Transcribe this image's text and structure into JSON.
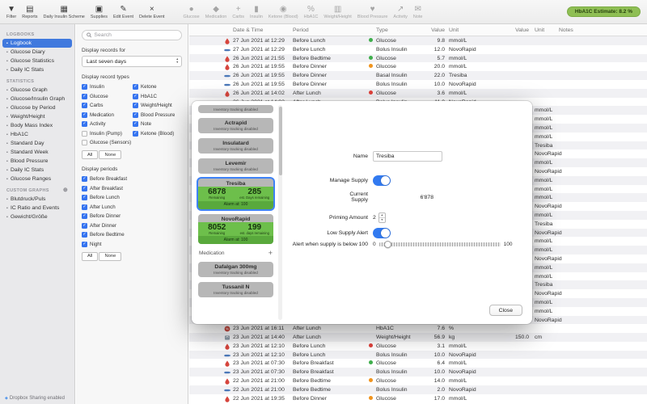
{
  "toolbar": {
    "badge": "HbA1C Estimate: 8.2 %",
    "items": [
      {
        "label": "Filter",
        "icon": "filter-icon"
      },
      {
        "label": "Reports",
        "icon": "reports-icon"
      },
      {
        "label": "Daily Insulin Scheme",
        "icon": "insulin-scheme-icon"
      },
      {
        "label": "Supplies",
        "icon": "supplies-icon"
      },
      {
        "label": "Edit Event",
        "icon": "edit-event-icon"
      },
      {
        "label": "Delete Event",
        "icon": "delete-event-icon"
      },
      {
        "label": "Glucose",
        "icon": "glucose-icon",
        "disabled": true,
        "group_start": true
      },
      {
        "label": "Medication",
        "icon": "medication-icon",
        "disabled": true
      },
      {
        "label": "Carbs",
        "icon": "carbs-icon",
        "disabled": true
      },
      {
        "label": "Insulin",
        "icon": "insulin-icon",
        "disabled": true
      },
      {
        "label": "Ketone (Blood)",
        "icon": "ketone-blood-icon",
        "disabled": true
      },
      {
        "label": "HbA1C",
        "icon": "hba1c-icon",
        "disabled": true
      },
      {
        "label": "Weight/Height",
        "icon": "weight-height-icon",
        "disabled": true
      },
      {
        "label": "Blood Pressure",
        "icon": "blood-pressure-icon",
        "disabled": true
      },
      {
        "label": "Activity",
        "icon": "activity-icon",
        "disabled": true
      },
      {
        "label": "Note",
        "icon": "note-icon",
        "disabled": true
      }
    ]
  },
  "sidebar": {
    "footer": "Dropbox Sharing enabled",
    "sections": [
      {
        "title": "LOGBOOKS",
        "items": [
          {
            "label": "Logbook",
            "selected": true
          },
          {
            "label": "Glucose Diary"
          },
          {
            "label": "Glucose Statistics"
          },
          {
            "label": "Daily IC Stats"
          }
        ]
      },
      {
        "title": "STATISTICS",
        "items": [
          {
            "label": "Glucose Graph"
          },
          {
            "label": "Glucose/Insulin Graph"
          },
          {
            "label": "Glucose by Period"
          },
          {
            "label": "Weight/Height"
          },
          {
            "label": "Body Mass Index"
          },
          {
            "label": "HbA1C"
          },
          {
            "label": "Standard Day"
          },
          {
            "label": "Standard Week"
          },
          {
            "label": "Blood Pressure"
          },
          {
            "label": "Daily IC Stats"
          },
          {
            "label": "Glucose Ranges"
          }
        ]
      },
      {
        "title": "CUSTOM GRAPHS",
        "plus": true,
        "items": [
          {
            "label": "Blutdruck/Puls"
          },
          {
            "label": "IC Ratio and Events"
          },
          {
            "label": "Gewicht/Größe"
          }
        ]
      }
    ]
  },
  "filters": {
    "search_placeholder": "Search",
    "records_for_label": "Display records for",
    "range_value": "Last seven days",
    "types_label": "Display record types",
    "record_types": [
      {
        "label": "Insulin",
        "checked": true
      },
      {
        "label": "Ketone",
        "checked": true
      },
      {
        "label": "Glucose",
        "checked": true
      },
      {
        "label": "HbA1C",
        "checked": true
      },
      {
        "label": "Carbs",
        "checked": true
      },
      {
        "label": "Weight/Height",
        "checked": true
      },
      {
        "label": "Medication",
        "checked": true
      },
      {
        "label": "Blood Pressure",
        "checked": true
      },
      {
        "label": "Activity",
        "checked": true
      },
      {
        "label": "Note",
        "checked": true
      },
      {
        "label": "Insulin (Pump)",
        "checked": false
      },
      {
        "label": "Ketone (Blood)",
        "checked": true
      },
      {
        "label": "Glucose (Sensors)",
        "checked": false
      }
    ],
    "all_label": "All",
    "none_label": "None",
    "periods_label": "Display periods",
    "periods": [
      {
        "label": "Before Breakfast",
        "checked": true
      },
      {
        "label": "After Breakfast",
        "checked": true
      },
      {
        "label": "Before Lunch",
        "checked": true
      },
      {
        "label": "After Lunch",
        "checked": true
      },
      {
        "label": "Before Dinner",
        "checked": true
      },
      {
        "label": "After Dinner",
        "checked": true
      },
      {
        "label": "Before Bedtime",
        "checked": true
      },
      {
        "label": "Night",
        "checked": true
      }
    ]
  },
  "table": {
    "columns": [
      "Date & Time",
      "Period",
      "Type",
      "Value",
      "Unit",
      "Value",
      "Unit",
      "Notes"
    ],
    "rows": [
      {
        "icon": "glucose",
        "dt": "27 Jun 2021 at 12:29",
        "period": "Before Lunch",
        "type": "Glucose",
        "dot": "green",
        "v1": "9.8",
        "u1": "mmol/L"
      },
      {
        "icon": "insulin",
        "dt": "27 Jun 2021 at 12:29",
        "period": "Before Lunch",
        "type": "Bolus Insulin",
        "v1": "12.0",
        "u1": "NovoRapid"
      },
      {
        "icon": "glucose",
        "dt": "26 Jun 2021 at 21:55",
        "period": "Before Bedtime",
        "type": "Glucose",
        "dot": "green",
        "v1": "5.7",
        "u1": "mmol/L"
      },
      {
        "icon": "glucose",
        "dt": "26 Jun 2021 at 19:55",
        "period": "Before Dinner",
        "type": "Glucose",
        "dot": "orange",
        "v1": "20.0",
        "u1": "mmol/L"
      },
      {
        "icon": "insulin",
        "dt": "26 Jun 2021 at 19:55",
        "period": "Before Dinner",
        "type": "Basal Insulin",
        "v1": "22.0",
        "u1": "Tresiba"
      },
      {
        "icon": "insulin",
        "dt": "26 Jun 2021 at 19:55",
        "period": "Before Dinner",
        "type": "Bolus Insulin",
        "v1": "10.0",
        "u1": "NovoRapid"
      },
      {
        "icon": "glucose",
        "dt": "26 Jun 2021 at 14:02",
        "period": "After Lunch",
        "type": "Glucose",
        "dot": "red",
        "v1": "3.6",
        "u1": "mmol/L"
      },
      {
        "icon": "insulin",
        "dt": "26 Jun 2021 at 14:02",
        "period": "After Lunch",
        "type": "Bolus Insulin",
        "v1": "11.0",
        "u1": "NovoRapid"
      },
      {
        "occluded": true,
        "u2": "mmol/L"
      },
      {
        "occluded": true,
        "u2": "mmol/L"
      },
      {
        "occluded": true,
        "u2": "mmol/L"
      },
      {
        "occluded": true,
        "u2": "mmol/L"
      },
      {
        "occluded": true,
        "u2": "Tresiba"
      },
      {
        "occluded": true,
        "u2": "NovoRapid"
      },
      {
        "occluded": true,
        "u2": "mmol/L"
      },
      {
        "occluded": true,
        "u2": "NovoRapid"
      },
      {
        "occluded": true,
        "u2": "mmol/L"
      },
      {
        "occluded": true,
        "u2": "mmol/L"
      },
      {
        "occluded": true,
        "u2": "mmol/L"
      },
      {
        "occluded": true,
        "u2": "NovoRapid"
      },
      {
        "occluded": true,
        "u2": "mmol/L"
      },
      {
        "occluded": true,
        "u2": "Tresiba"
      },
      {
        "occluded": true,
        "u2": "NovoRapid"
      },
      {
        "occluded": true,
        "u2": "mmol/L"
      },
      {
        "occluded": true,
        "u2": "mmol/L"
      },
      {
        "occluded": true,
        "u2": "NovoRapid"
      },
      {
        "occluded": true,
        "u2": "mmol/L"
      },
      {
        "occluded": true,
        "u2": "mmol/L"
      },
      {
        "occluded": true,
        "u2": "Tresiba"
      },
      {
        "occluded": true,
        "u2": "NovoRapid"
      },
      {
        "occluded": true,
        "u2": "mmol/L"
      },
      {
        "occluded": true,
        "u2": "mmol/L"
      },
      {
        "occluded": true,
        "u2": "NovoRapid"
      },
      {
        "icon": "hba1c",
        "dt": "23 Jun 2021 at 16:11",
        "period": "After Lunch",
        "type": "HbA1C",
        "v1": "7.6",
        "u1": "%"
      },
      {
        "icon": "weight",
        "dt": "23 Jun 2021 at 14:40",
        "period": "After Lunch",
        "type": "Weight/Height",
        "v1": "56.9",
        "u1": "kg",
        "v2": "150.0",
        "u2": "cm"
      },
      {
        "icon": "glucose",
        "dt": "23 Jun 2021 at 12:10",
        "period": "Before Lunch",
        "type": "Glucose",
        "dot": "red",
        "v1": "3.1",
        "u1": "mmol/L"
      },
      {
        "icon": "insulin",
        "dt": "23 Jun 2021 at 12:10",
        "period": "Before Lunch",
        "type": "Bolus Insulin",
        "v1": "10.0",
        "u1": "NovoRapid"
      },
      {
        "icon": "glucose",
        "dt": "23 Jun 2021 at 07:30",
        "period": "Before Breakfast",
        "type": "Glucose",
        "dot": "green",
        "v1": "6.4",
        "u1": "mmol/L"
      },
      {
        "icon": "insulin",
        "dt": "23 Jun 2021 at 07:30",
        "period": "Before Breakfast",
        "type": "Bolus Insulin",
        "v1": "10.0",
        "u1": "NovoRapid"
      },
      {
        "icon": "glucose",
        "dt": "22 Jun 2021 at 21:00",
        "period": "Before Bedtime",
        "type": "Glucose",
        "dot": "orange",
        "v1": "14.0",
        "u1": "mmol/L"
      },
      {
        "icon": "insulin",
        "dt": "22 Jun 2021 at 21:00",
        "period": "Before Bedtime",
        "type": "Bolus Insulin",
        "v1": "2.0",
        "u1": "NovoRapid"
      },
      {
        "icon": "glucose",
        "dt": "22 Jun 2021 at 19:35",
        "period": "Before Dinner",
        "type": "Glucose",
        "dot": "orange",
        "v1": "17.0",
        "u1": "mmol/L"
      }
    ]
  },
  "dialog": {
    "supplies": [
      {
        "partial": true,
        "status": "Inventory tracking disabled"
      },
      {
        "name": "Actrapid",
        "status": "Inventory tracking disabled"
      },
      {
        "name": "Insulatard",
        "status": "Inventory tracking disabled"
      },
      {
        "name": "Levemir",
        "status": "Inventory tracking disabled"
      },
      {
        "name": "Tresiba",
        "selected": true,
        "remaining": "6878",
        "remaining_label": "Remaining",
        "days": "285",
        "days_label": "est. Days remaining",
        "alarm": "Alarm at: 100"
      },
      {
        "name": "NovoRapid",
        "remaining": "8052",
        "remaining_label": "Remaining",
        "days": "199",
        "days_label": "est. days remaining",
        "alarm": "Alarm at: 100"
      }
    ],
    "medication": {
      "title": "Medication",
      "add_label": "+"
    },
    "medications": [
      {
        "name": "Dafalgan 300mg",
        "status": "Inventory tracking disabled"
      },
      {
        "name": "Tussanil N",
        "status": "Inventory tracking disabled"
      }
    ],
    "form": {
      "name_label": "Name",
      "name_value": "Tresiba",
      "manage_label": "Manage Supply",
      "current_label": "Current Supply",
      "current_value": "6'878",
      "priming_label": "Priming Amount",
      "priming_value": "2",
      "low_alert_label": "Low Supply Alert",
      "alert_label": "Alert when supply is below 100",
      "slider_min": "0",
      "slider_max": "100"
    },
    "close_label": "Close"
  }
}
